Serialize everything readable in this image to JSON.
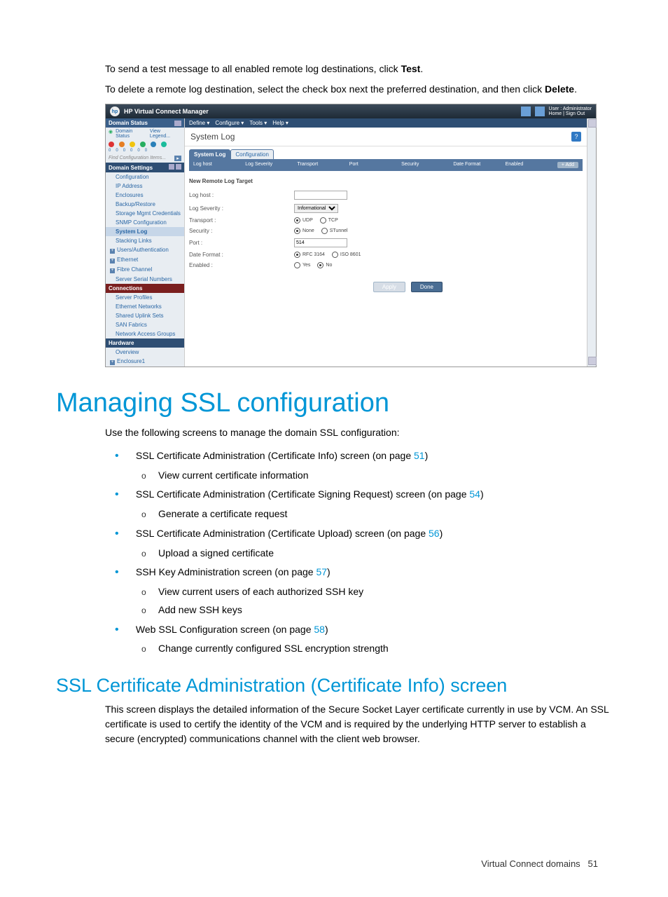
{
  "intro": {
    "p1_a": "To send a test message to all enabled remote log destinations, click ",
    "p1_b": "Test",
    "p1_c": ".",
    "p2_a": "To delete a remote log destination, select the check box next the preferred destination, and then click ",
    "p2_b": "Delete",
    "p2_c": "."
  },
  "ss": {
    "header_title": "HP Virtual Connect Manager",
    "user_line1": "User : Administrator",
    "user_line2": "Home | Sign Out",
    "menubar": [
      "Define ▾",
      "Configure ▾",
      "Tools ▾",
      "Help ▾"
    ],
    "left": {
      "domain_status": "Domain Status",
      "status_link": "Domain Status",
      "legend_link": "View Legend...",
      "search_placeholder": "Find Configuration Items...",
      "domain_settings": "Domain Settings",
      "tree": [
        "Configuration",
        "IP Address",
        "Enclosures",
        "Backup/Restore",
        "Storage Mgmt Credentials",
        "SNMP Configuration",
        "System Log",
        "Stacking Links",
        "Users/Authentication",
        "Ethernet",
        "Fibre Channel",
        "Server Serial Numbers"
      ],
      "connections": "Connections",
      "conn_items": [
        "Server Profiles",
        "Ethernet Networks",
        "Shared Uplink Sets",
        "SAN Fabrics",
        "Network Access Groups"
      ],
      "hardware": "Hardware",
      "hw_items": [
        "Overview",
        "Enclosure1"
      ]
    },
    "main": {
      "title": "System Log",
      "tabs": [
        "System Log",
        "Configuration"
      ],
      "tbl_headers": [
        "Log host",
        "Log Severity",
        "Transport",
        "Port",
        "Security",
        "Date Format",
        "Enabled"
      ],
      "add_btn": "+ Add",
      "form_title": "New Remote Log Target",
      "rows": {
        "log_host": "Log host :",
        "log_sev": "Log Severity :",
        "sev_val": "Informational",
        "transport": "Transport :",
        "udp": "UDP",
        "tcp": "TCP",
        "security": "Security :",
        "none": "None",
        "stunnel": "STunnel",
        "port": "Port :",
        "port_val": "514",
        "date_fmt": "Date Format :",
        "rfc": "RFC 3164",
        "iso": "ISO 8601",
        "enabled": "Enabled :",
        "yes": "Yes",
        "no": "No"
      },
      "btn_apply": "Apply",
      "btn_done": "Done"
    }
  },
  "h1": "Managing SSL configuration",
  "p_after_h1": "Use the following screens to manage the domain SSL configuration:",
  "bullets": [
    {
      "text": "SSL Certificate Administration (Certificate Info) screen (on page ",
      "link": "51",
      "tail": ")",
      "subs": [
        "View current certificate information"
      ]
    },
    {
      "text": "SSL Certificate Administration (Certificate Signing Request) screen (on page ",
      "link": "54",
      "tail": ")",
      "subs": [
        "Generate a certificate request"
      ]
    },
    {
      "text": "SSL Certificate Administration (Certificate Upload) screen (on page ",
      "link": "56",
      "tail": ")",
      "subs": [
        "Upload a signed certificate"
      ]
    },
    {
      "text": "SSH Key Administration screen (on page ",
      "link": "57",
      "tail": ")",
      "subs": [
        "View current users of each authorized SSH key",
        "Add new SSH keys"
      ]
    },
    {
      "text": "Web SSL Configuration screen (on page ",
      "link": "58",
      "tail": ")",
      "subs": [
        "Change currently configured SSL encryption strength"
      ]
    }
  ],
  "h2": "SSL Certificate Administration (Certificate Info) screen",
  "p_after_h2": "This screen displays the detailed information of the Secure Socket Layer certificate currently in use by VCM. An SSL certificate is used to certify the identity of the VCM and is required by the underlying HTTP server to establish a secure (encrypted) communications channel with the client web browser.",
  "footer_text": "Virtual Connect domains",
  "footer_page": "51"
}
